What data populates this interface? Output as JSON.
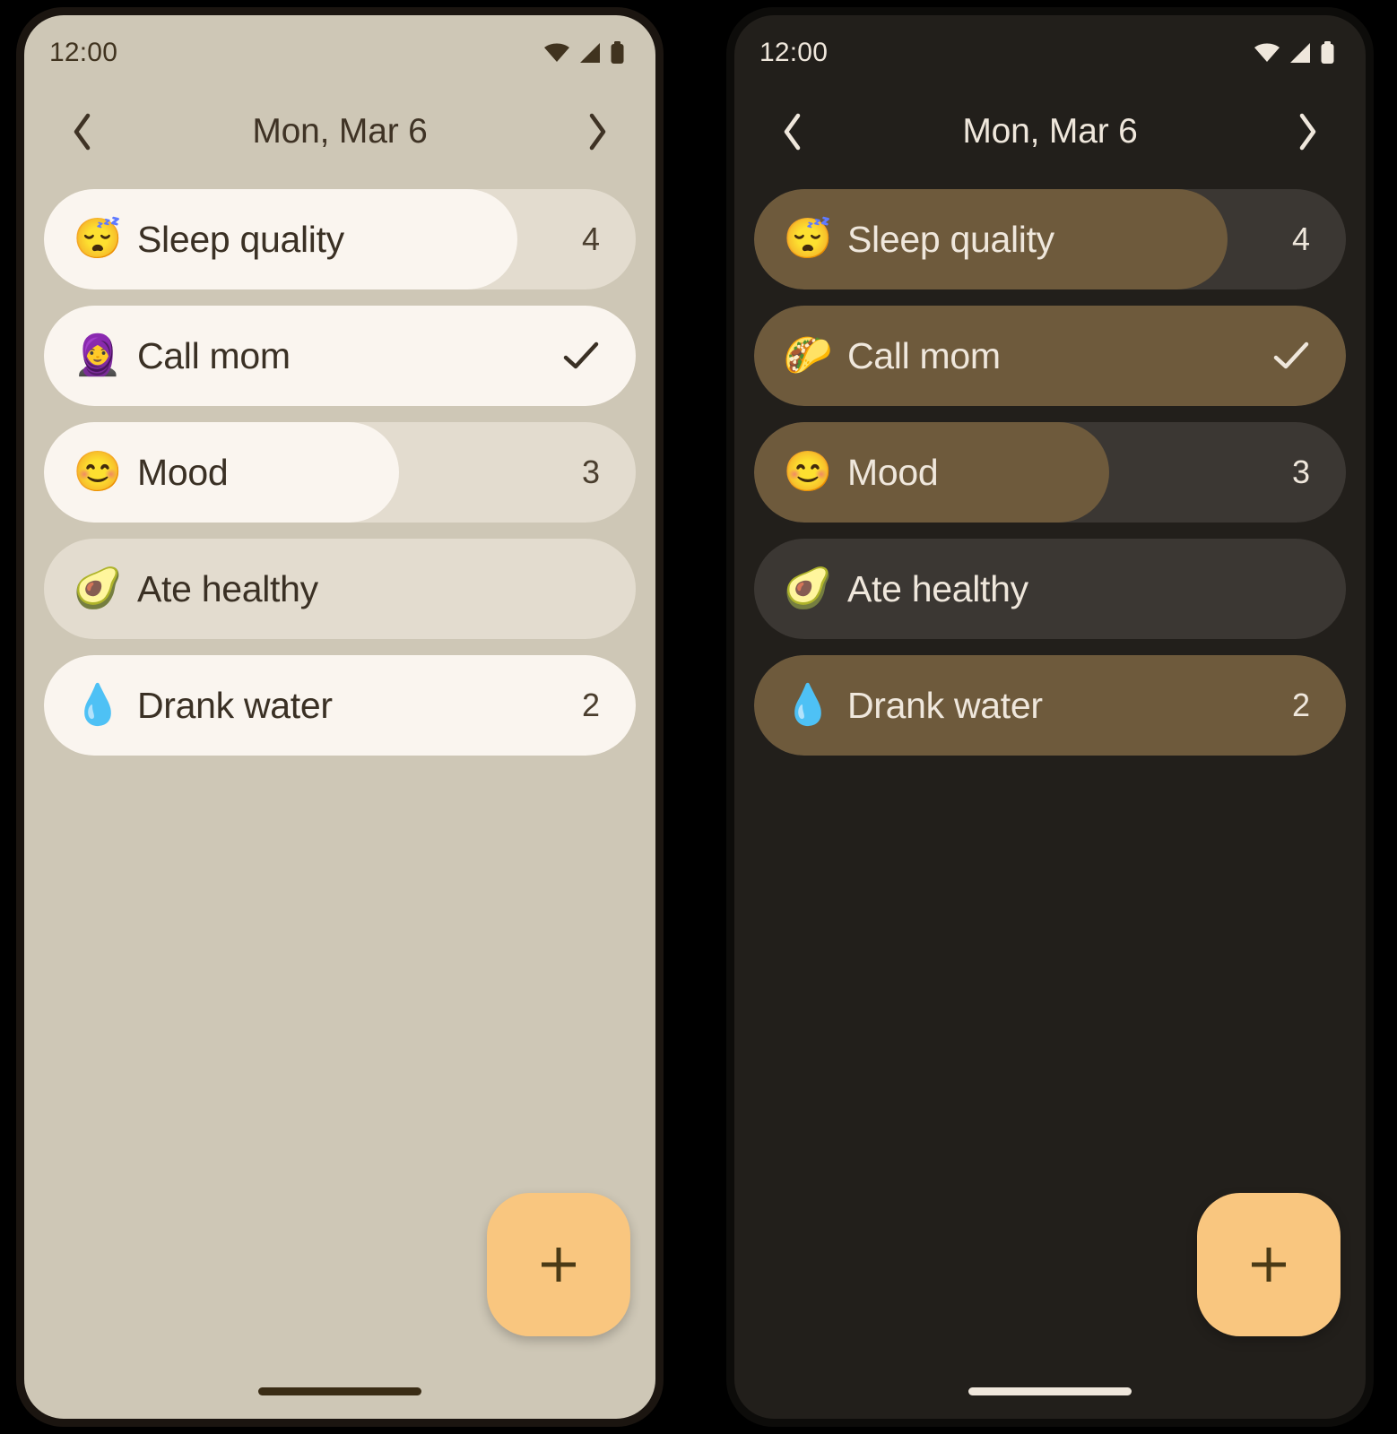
{
  "screens": [
    {
      "theme": "light",
      "status_bar": {
        "time": "12:00",
        "icons": [
          "wifi-icon",
          "cellular-icon",
          "battery-icon"
        ]
      },
      "header": {
        "prev_label": "chevron-left-icon",
        "title": "Mon, Mar 6",
        "next_label": "chevron-right-icon"
      },
      "habits": [
        {
          "emoji": "😴",
          "emoji_name": "sleeping-face-emoji",
          "label": "Sleep quality",
          "value": "4",
          "completed": false,
          "progress_pct": 80
        },
        {
          "emoji": "🧕",
          "emoji_name": "woman-with-headscarf-emoji",
          "label": "Call mom",
          "value": "",
          "completed": true,
          "progress_pct": 100
        },
        {
          "emoji": "😊",
          "emoji_name": "smiling-face-emoji",
          "label": "Mood",
          "value": "3",
          "completed": false,
          "progress_pct": 60
        },
        {
          "emoji": "🥑",
          "emoji_name": "avocado-emoji",
          "label": "Ate healthy",
          "value": "",
          "completed": false,
          "progress_pct": 0
        },
        {
          "emoji": "💧",
          "emoji_name": "droplet-emoji",
          "label": "Drank water",
          "value": "2",
          "completed": false,
          "progress_pct": 100
        }
      ],
      "fab": {
        "label": "+",
        "name": "add-habit-button"
      },
      "colors": {
        "background": "#CEC7B6",
        "track": "#E3DCCF",
        "fill": "#FAF5EF",
        "text": "#3A3024",
        "accent": "#F9C67F"
      }
    },
    {
      "theme": "dark",
      "status_bar": {
        "time": "12:00",
        "icons": [
          "wifi-icon",
          "cellular-icon",
          "battery-icon"
        ]
      },
      "header": {
        "prev_label": "chevron-left-icon",
        "title": "Mon, Mar 6",
        "next_label": "chevron-right-icon"
      },
      "habits": [
        {
          "emoji": "😴",
          "emoji_name": "sleeping-face-emoji",
          "label": "Sleep quality",
          "value": "4",
          "completed": false,
          "progress_pct": 80
        },
        {
          "emoji": "🌮",
          "emoji_name": "taco-emoji",
          "label": "Call mom",
          "value": "",
          "completed": true,
          "progress_pct": 100
        },
        {
          "emoji": "😊",
          "emoji_name": "smiling-face-emoji",
          "label": "Mood",
          "value": "3",
          "completed": false,
          "progress_pct": 60
        },
        {
          "emoji": "🥑",
          "emoji_name": "avocado-emoji",
          "label": "Ate healthy",
          "value": "",
          "completed": false,
          "progress_pct": 0
        },
        {
          "emoji": "💧",
          "emoji_name": "droplet-emoji",
          "label": "Drank water",
          "value": "2",
          "completed": false,
          "progress_pct": 100
        }
      ],
      "fab": {
        "label": "+",
        "name": "add-habit-button"
      },
      "colors": {
        "background": "#221F1B",
        "track": "#3B3733",
        "fill": "#6E5A3C",
        "text": "#EFE7DC",
        "accent": "#F9C67F"
      }
    }
  ]
}
